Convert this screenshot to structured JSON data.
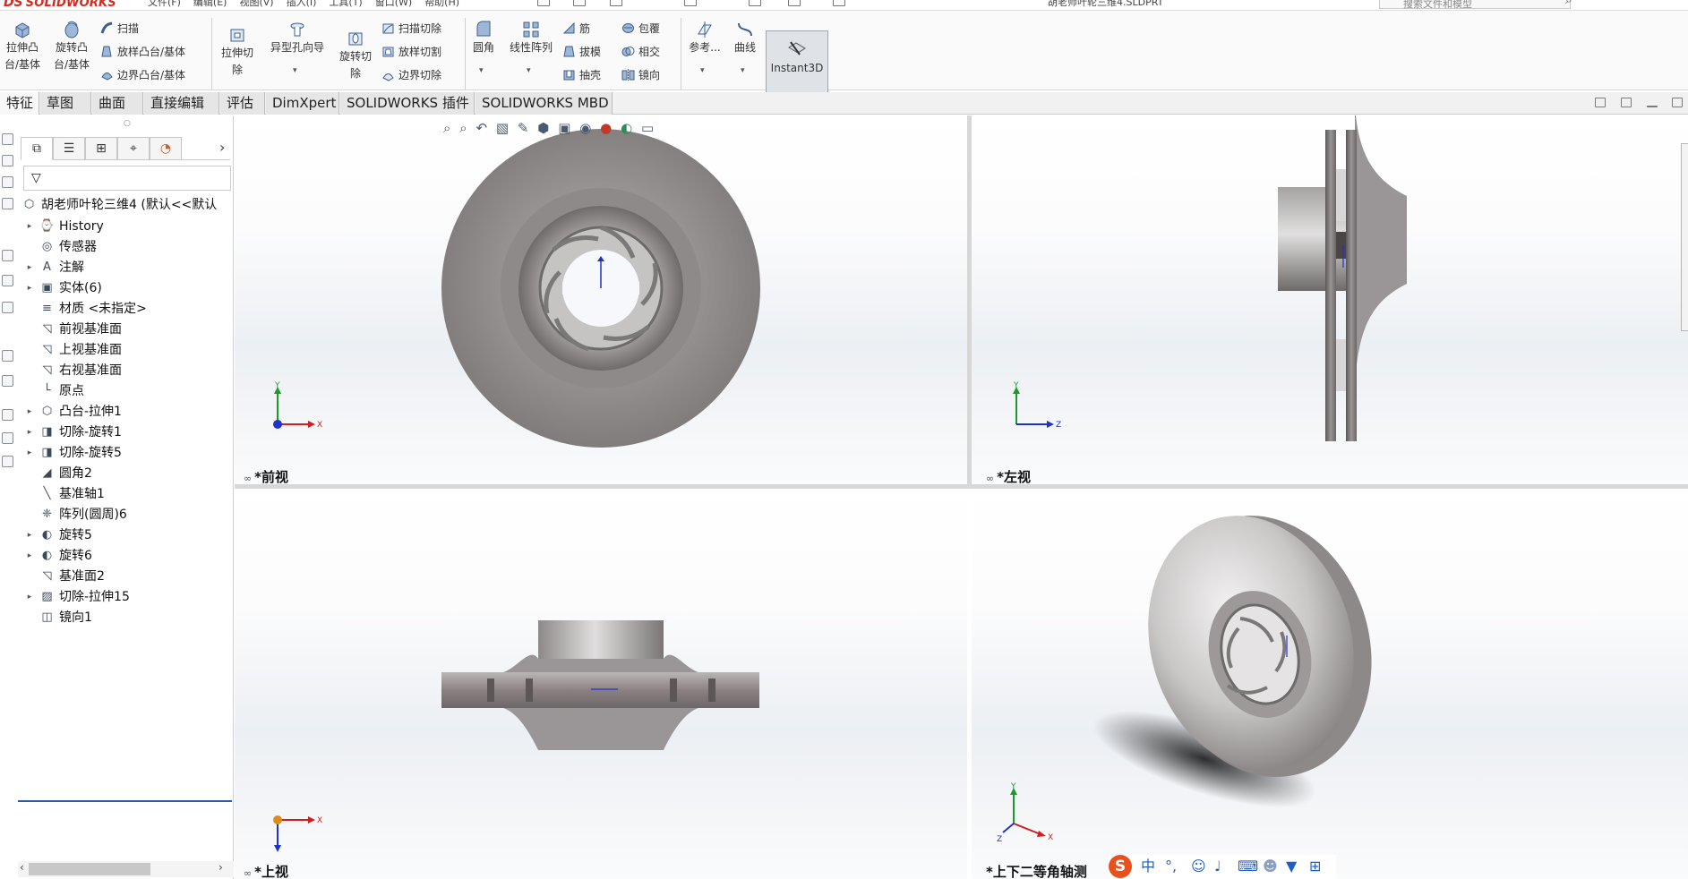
{
  "app": {
    "name": "SOLIDWORKS",
    "document_title": "胡老师叶轮三维4.SLDPRT",
    "menus": [
      "文件(F)",
      "编辑(E)",
      "视图(V)",
      "插入(I)",
      "工具(T)",
      "窗口(W)",
      "帮助(H)"
    ],
    "search_placeholder": "搜索文件和模型"
  },
  "ribbon": {
    "extrude_boss": "拉伸凸\n台/基体",
    "revolve_boss": "旋转凸\n台/基体",
    "sweep": "扫描",
    "loft_boss": "放样凸台/基体",
    "boundary_boss": "边界凸台/基体",
    "extrude_cut": "拉伸切\n除",
    "hole_wizard": "异型孔向导",
    "revolve_cut": "旋转切\n除",
    "sweep_cut": "扫描切除",
    "loft_cut": "放样切割",
    "boundary_cut": "边界切除",
    "fillet": "圆角",
    "linear_pattern": "线性阵列",
    "rib": "筋",
    "draft": "拔模",
    "shell": "抽壳",
    "wrap": "包覆",
    "intersect": "相交",
    "mirror": "镜向",
    "reference": "参考...",
    "curves": "曲线",
    "instant3d": "Instant3D"
  },
  "tabs": [
    "特征",
    "草图",
    "曲面",
    "直接编辑",
    "评估",
    "DimXpert",
    "SOLIDWORKS 插件",
    "SOLIDWORKS MBD"
  ],
  "tree": {
    "root": "胡老师叶轮三维4 (默认<<默认",
    "items": [
      {
        "label": "History",
        "icon": "history-icon",
        "expandable": true
      },
      {
        "label": "传感器",
        "icon": "sensor-icon",
        "expandable": false
      },
      {
        "label": "注解",
        "icon": "annotation-icon",
        "expandable": true
      },
      {
        "label": "实体(6)",
        "icon": "solid-bodies-icon",
        "expandable": true
      },
      {
        "label": "材质 <未指定>",
        "icon": "material-icon",
        "expandable": false
      },
      {
        "label": "前视基准面",
        "icon": "plane-icon",
        "expandable": false
      },
      {
        "label": "上视基准面",
        "icon": "plane-icon",
        "expandable": false
      },
      {
        "label": "右视基准面",
        "icon": "plane-icon",
        "expandable": false
      },
      {
        "label": "原点",
        "icon": "origin-icon",
        "expandable": false
      },
      {
        "label": "凸台-拉伸1",
        "icon": "extrude-icon",
        "expandable": true
      },
      {
        "label": "切除-旋转1",
        "icon": "revolve-cut-icon",
        "expandable": true
      },
      {
        "label": "切除-旋转5",
        "icon": "revolve-cut-icon",
        "expandable": true
      },
      {
        "label": "圆角2",
        "icon": "fillet-icon",
        "expandable": false
      },
      {
        "label": "基准轴1",
        "icon": "axis-icon",
        "expandable": false
      },
      {
        "label": "阵列(圆周)6",
        "icon": "circular-pattern-icon",
        "expandable": false
      },
      {
        "label": "旋转5",
        "icon": "revolve-icon",
        "expandable": true
      },
      {
        "label": "旋转6",
        "icon": "revolve-icon",
        "expandable": true
      },
      {
        "label": "基准面2",
        "icon": "plane-icon",
        "expandable": false
      },
      {
        "label": "切除-拉伸15",
        "icon": "extrude-cut-icon",
        "expandable": true
      },
      {
        "label": "镜向1",
        "icon": "mirror-icon",
        "expandable": false
      }
    ]
  },
  "viewports": {
    "front": "*前视",
    "left": "*左视",
    "top": "*上视",
    "iso": "*上下二等角轴测"
  },
  "axes": {
    "x": "X",
    "y": "Y",
    "z": "Z"
  },
  "ime": {
    "logo": "S",
    "mode": "中",
    "punct": "°,"
  },
  "colors": {
    "brand": "#d42a1f",
    "model_metal": "#8c8887",
    "axis_x": "#cc1f1f",
    "axis_y": "#1a9a2a",
    "axis_z": "#1f33cc"
  }
}
